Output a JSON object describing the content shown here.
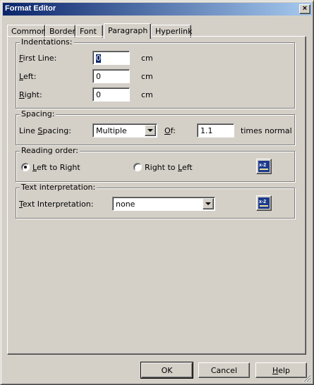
{
  "window": {
    "title": "Format Editor",
    "close_glyph": "×"
  },
  "tabs": [
    {
      "label": "Common",
      "active": false
    },
    {
      "label": "Border",
      "active": false
    },
    {
      "label": "Font",
      "active": false
    },
    {
      "label": "Paragraph",
      "active": true
    },
    {
      "label": "Hyperlink",
      "active": false
    }
  ],
  "indentations": {
    "group_label": "Indentations:",
    "first_line": {
      "mnemonic": "F",
      "rest": "irst Line:",
      "value": "0",
      "unit": "cm"
    },
    "left": {
      "mnemonic": "L",
      "rest": "eft:",
      "value": "0",
      "unit": "cm"
    },
    "right": {
      "mnemonic": "R",
      "rest": "ight:",
      "value": "0",
      "unit": "cm"
    }
  },
  "spacing": {
    "group_label": "Spacing:",
    "line_spacing_pre": "Line ",
    "line_spacing_mnemonic": "S",
    "line_spacing_post": "pacing:",
    "line_spacing_value": "Multiple",
    "of_mnemonic": "O",
    "of_rest": "f:",
    "of_value": "1.1",
    "of_unit": "times normal"
  },
  "reading_order": {
    "group_label": "Reading order:",
    "ltr_mnemonic": "L",
    "ltr_rest": "eft to Right",
    "ltr_checked": true,
    "rtl_pre": "Right to ",
    "rtl_mnemonic": "L",
    "rtl_rest": "eft",
    "rtl_checked": false,
    "formula_icon": "formula-x-icon"
  },
  "text_interpretation": {
    "group_label": "Text interpretation:",
    "label_mnemonic": "T",
    "label_rest": "ext Interpretation:",
    "value": "none",
    "formula_icon": "formula-x-icon"
  },
  "buttons": {
    "ok": "OK",
    "cancel": "Cancel",
    "help_mnemonic": "H",
    "help_rest": "elp"
  },
  "colors": {
    "face": "#d4d0c8",
    "title_start": "#0a246a",
    "title_end": "#a6caf0",
    "selection": "#0a246a"
  }
}
